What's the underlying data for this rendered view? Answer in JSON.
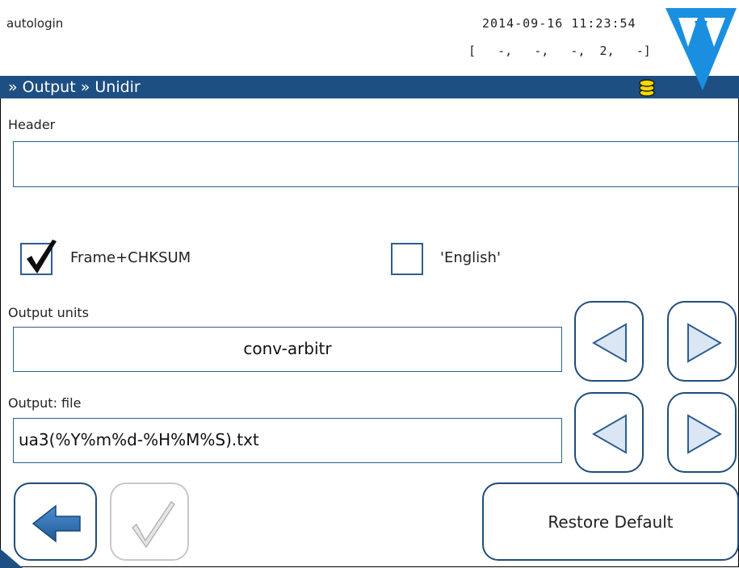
{
  "status": {
    "user": "autologin",
    "datetime": "2014-09-16 11:23:54",
    "readout": "[   -,   -,   -,  2,   -]"
  },
  "breadcrumb": "» Output » Unidir",
  "form": {
    "header_label": "Header",
    "header_value": "",
    "frame_checksum": {
      "label": "Frame+CHKSUM",
      "checked": true
    },
    "english": {
      "label": "'English'",
      "checked": false
    },
    "output_units_label": "Output units",
    "output_units_value": "conv-arbitr",
    "output_file_label": "Output: file",
    "output_file_value": "ua3(%Y%m%d-%H%M%S).txt"
  },
  "buttons": {
    "restore_default": "Restore Default"
  },
  "colors": {
    "nav_bar": "#1e4f82",
    "accent": "#2c5f90",
    "logo": "#1a8fe0",
    "coin": "#f5d800"
  },
  "icons": [
    "logo-icon",
    "database-icon",
    "check-icon",
    "arrow-left-icon",
    "triangle-left-icon",
    "triangle-right-icon"
  ]
}
